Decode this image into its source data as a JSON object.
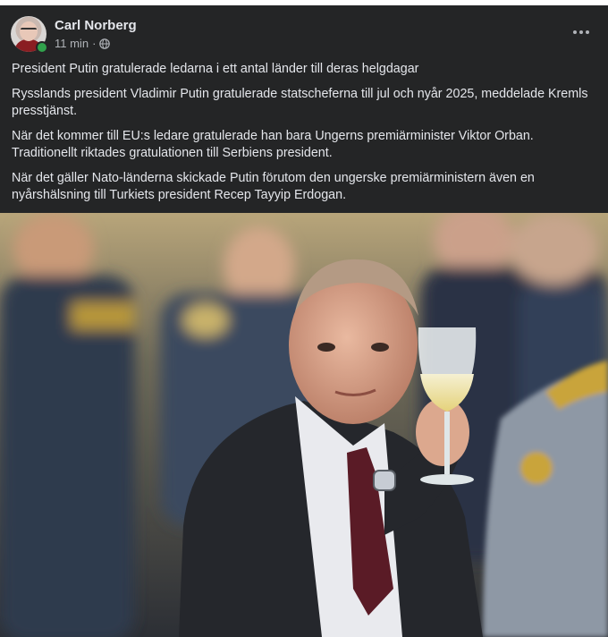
{
  "post": {
    "author": "Carl Norberg",
    "timestamp": "11 min",
    "separator": "·",
    "privacy_icon": "globe-icon",
    "more_icon": "more-horizontal-icon",
    "paragraphs": [
      "President Putin gratulerade ledarna i ett antal länder till deras helgdagar",
      "Rysslands president Vladimir Putin gratulerade statscheferna till jul och nyår 2025, meddelade Kremls presstjänst.",
      "När det kommer till EU:s ledare gratulerade han bara Ungerns premiärminister Viktor Orban. Traditionellt riktades gratulationen till Serbiens president.",
      "När det gäller Nato-länderna skickade Putin förutom den ungerske premiärministern även en nyårshälsning till Turkiets president Recep Tayyip Erdogan."
    ]
  },
  "colors": {
    "background": "#242526",
    "text_primary": "#e4e6eb",
    "text_secondary": "#b0b3b8",
    "online": "#31a24c"
  }
}
